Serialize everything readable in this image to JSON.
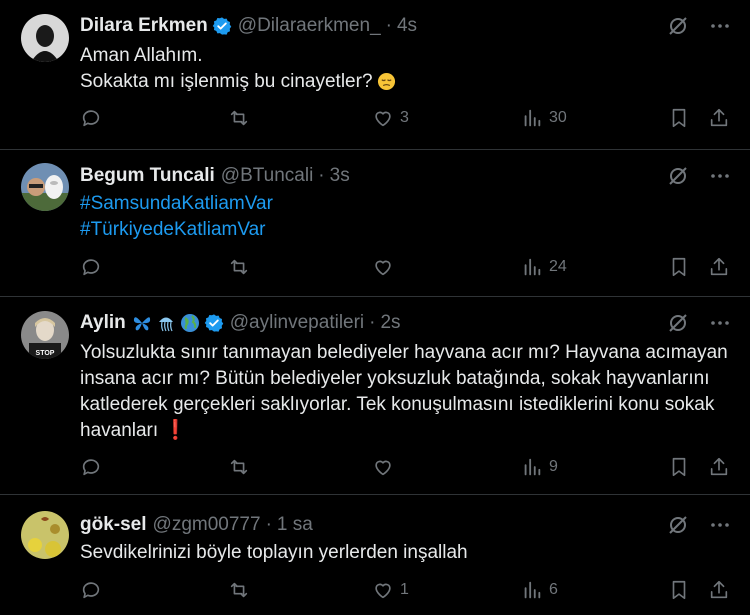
{
  "tweets": [
    {
      "name": "Dilara Erkmen",
      "verified": true,
      "handle": "@Dilaraerkmen_",
      "time": "4s",
      "text_lines": [
        "Aman Allahım.",
        "Sokakta mı işlenmiş bu cinayetler?"
      ],
      "has_emoji": true,
      "replies": "",
      "retweets": "",
      "likes": "3",
      "views": "30"
    },
    {
      "name": "Begum Tuncali",
      "verified": false,
      "handle": "@BTuncali",
      "time": "3s",
      "hashtags": [
        "#SamsundaKatliamVar",
        "#TürkiyedeKatliamVar"
      ],
      "replies": "",
      "retweets": "",
      "likes": "",
      "views": "24"
    },
    {
      "name": "Aylin",
      "verified": true,
      "handle": "@aylinvepatileri",
      "time": "2s",
      "text": "Yolsuzlukta sınır tanımayan belediyeler hayvana acır mı? Hayvana acımayan insana acır mı? Bütün belediyeler yoksuzluk batağında,  sokak hayvanlarını katlederek gerçekleri saklıyorlar. Tek konuşulmasını istediklerini konu sokak havanları ❗",
      "replies": "",
      "retweets": "",
      "likes": "",
      "views": "9"
    },
    {
      "name": "gök-sel",
      "verified": false,
      "handle": "@zgm00777",
      "time": "1 sa",
      "text": "Sevdikelrinizi böyle toplayın yerlerden inşallah",
      "replies": "",
      "retweets": "",
      "likes": "1",
      "views": "6"
    }
  ],
  "colors": {
    "background": "#000000",
    "text": "#e7e9ea",
    "muted": "#71767b",
    "link": "#1d9bf0",
    "divider": "#2f3336",
    "verified": "#1d9bf0"
  },
  "icons": {
    "grok": "grok-icon",
    "more": "more-icon",
    "reply": "reply-icon",
    "retweet": "retweet-icon",
    "like": "heart-icon",
    "views": "views-icon",
    "bookmark": "bookmark-icon",
    "share": "share-icon"
  }
}
